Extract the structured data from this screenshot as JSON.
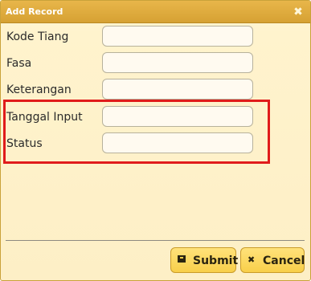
{
  "dialog": {
    "title": "Add Record",
    "close_symbol": "✖"
  },
  "fields": [
    {
      "label": "Kode Tiang",
      "value": "",
      "placeholder": ""
    },
    {
      "label": "Fasa",
      "value": "",
      "placeholder": ""
    },
    {
      "label": "Keterangan",
      "value": "",
      "placeholder": ""
    },
    {
      "label": "Tanggal Input",
      "value": "",
      "placeholder": ""
    },
    {
      "label": "Status",
      "value": "",
      "placeholder": ""
    }
  ],
  "buttons": {
    "submit_label": "Submit",
    "submit_icon": "save-icon",
    "cancel_label": "Cancel",
    "cancel_icon": "close-icon",
    "cancel_symbol": "✖"
  },
  "colors": {
    "titlebar": "#d9a537",
    "dialog_background": "#fff3cd",
    "button_background": "#f8cf4a",
    "highlight": "#e01b1b"
  }
}
